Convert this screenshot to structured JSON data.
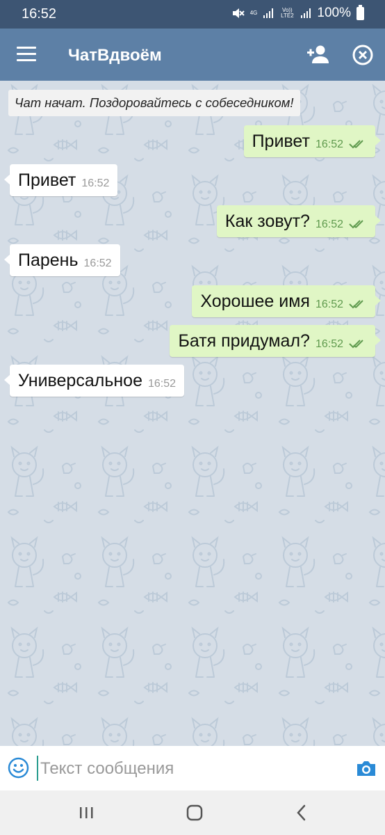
{
  "status_bar": {
    "time": "16:52",
    "network_top": "4G",
    "volte_label": "Vo)) LTE2",
    "battery": "100%"
  },
  "app_bar": {
    "title": "ЧатВдвоём"
  },
  "chat": {
    "system_message": "Чат начат. Поздоровайтесь с собеседником!",
    "messages": [
      {
        "direction": "out",
        "text": "Привет",
        "time": "16:52"
      },
      {
        "direction": "in",
        "text": "Привет",
        "time": "16:52"
      },
      {
        "direction": "out",
        "text": "Как зовут?",
        "time": "16:52"
      },
      {
        "direction": "in",
        "text": "Парень",
        "time": "16:52"
      },
      {
        "direction": "out",
        "text": "Хорошее имя",
        "time": "16:52"
      },
      {
        "direction": "out",
        "text": "Батя придумал?",
        "time": "16:52"
      },
      {
        "direction": "in",
        "text": "Универсальное",
        "time": "16:52"
      }
    ]
  },
  "input_bar": {
    "placeholder": "Текст сообщения",
    "value": ""
  },
  "icons": {
    "menu": "menu-icon",
    "add_user": "add-user-icon",
    "close": "close-circle-icon",
    "emoji": "emoji-icon",
    "camera": "camera-icon",
    "read": "double-check-icon"
  },
  "colors": {
    "status_bar": "#3d5573",
    "app_bar": "#5d80a6",
    "chat_bg": "#d5dde6",
    "outgoing_bubble": "#e0f6c5",
    "incoming_bubble": "#ffffff",
    "accent": "#2a8ad6"
  }
}
